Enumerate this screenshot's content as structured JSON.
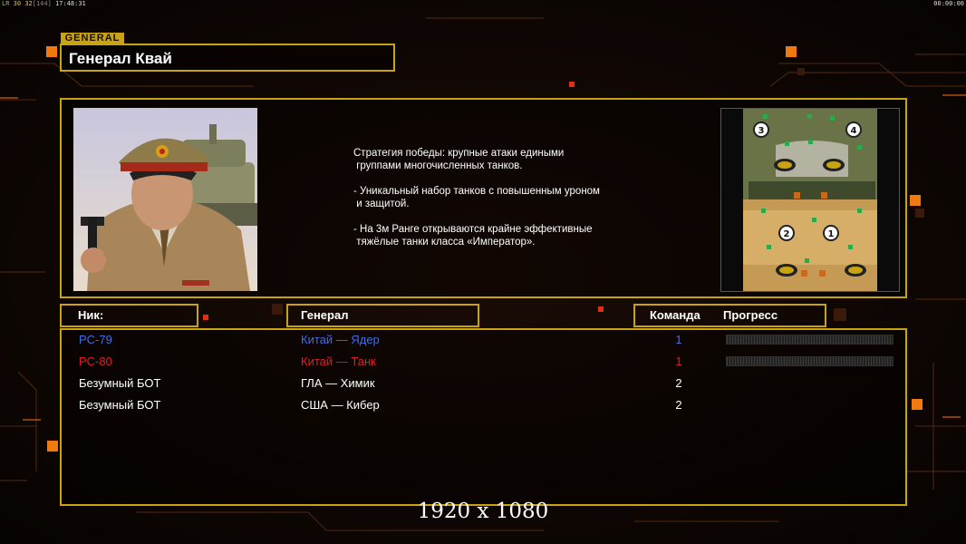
{
  "hud": {
    "fps_label": "LR",
    "fps_a": "30",
    "fps_b": "32",
    "fps_c": "[144]",
    "clock": "17:48:31",
    "timer": "00:00:00"
  },
  "header": {
    "tag": "GENERAL",
    "name": "Генерал Квай"
  },
  "strategy": {
    "line1": "Стратегия победы: крупные атаки едиными",
    "line2": " группами многочисленных танков.",
    "line3": "- Уникальный набор танков с повышенным уроном",
    "line4": " и защитой.",
    "line5": "- На 3м Ранге открываются крайне эффективные",
    "line6": " тяжёлые танки класса «Император»."
  },
  "map": {
    "slots": [
      "3",
      "4",
      "2",
      "1"
    ]
  },
  "columns": {
    "nick": "Ник:",
    "general": "Генерал",
    "team": "Команда",
    "progress": "Прогресс"
  },
  "players": [
    {
      "nick": "PC-79",
      "general": "Китай — Ядер",
      "team": "1",
      "color": "#3f6ee8",
      "progress": true
    },
    {
      "nick": "PC-80",
      "general": "Китай — Танк",
      "team": "1",
      "color": "#e02020",
      "progress": true
    },
    {
      "nick": "Безумный БОТ",
      "general": "ГЛА — Химик",
      "team": "2",
      "color": "#ffffff",
      "progress": false
    },
    {
      "nick": "Безумный БОТ",
      "general": "США — Кибер",
      "team": "2",
      "color": "#ffffff",
      "progress": false
    }
  ],
  "footer": {
    "resolution": "1920 x 1080"
  },
  "colors": {
    "frame": "#c9a412",
    "accent": "#f07a10"
  }
}
